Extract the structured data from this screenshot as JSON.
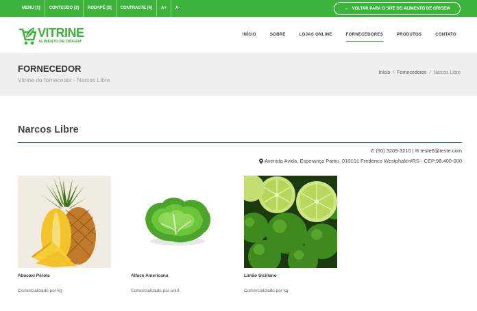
{
  "accessibility_bar": {
    "links": [
      "MENU [1]",
      "CONTEÚDO [2]",
      "RODAPÉ [3]",
      "CONTRASTE [4]",
      "A+",
      "A-"
    ],
    "back_button": "VOLTAR PARA O SITE DO ALIMENTO DE ORIGEM"
  },
  "logo": {
    "name": "VITRINE",
    "tagline": "ALIMENTO DE ORIGEM"
  },
  "nav": {
    "items": [
      "INÍCIO",
      "SOBRE",
      "LOJAS ONLINE",
      "FORNECEDORES",
      "PRODUTOS",
      "CONTATO"
    ],
    "active": "FORNECEDORES"
  },
  "page_header": {
    "title": "FORNECEDOR",
    "subtitle": "Vitrine do fornecedor - Narcos Libre",
    "breadcrumb": [
      "Início",
      "Fornecedores",
      "Narcos Libre"
    ]
  },
  "supplier": {
    "name": "Narcos Libre",
    "phone": "(90) 3209-3210",
    "separator": "|",
    "email": "teste6@teste.com",
    "address": "Avenida Avida, Esperança Partiu, 010101 Frederico Westphalen/RS - CEP:98.400-000"
  },
  "products": [
    {
      "name": "Abacaxi Pérola",
      "sold_by": "Comercializado por kg"
    },
    {
      "name": "Alface Americana",
      "sold_by": "Comercializado por unid"
    },
    {
      "name": "Limão Siciliano",
      "sold_by": "Comercializado por kg"
    }
  ],
  "colors": {
    "brand_green": "#3db33d",
    "band_bg": "#efefef",
    "rule": "#1a7a7a"
  }
}
